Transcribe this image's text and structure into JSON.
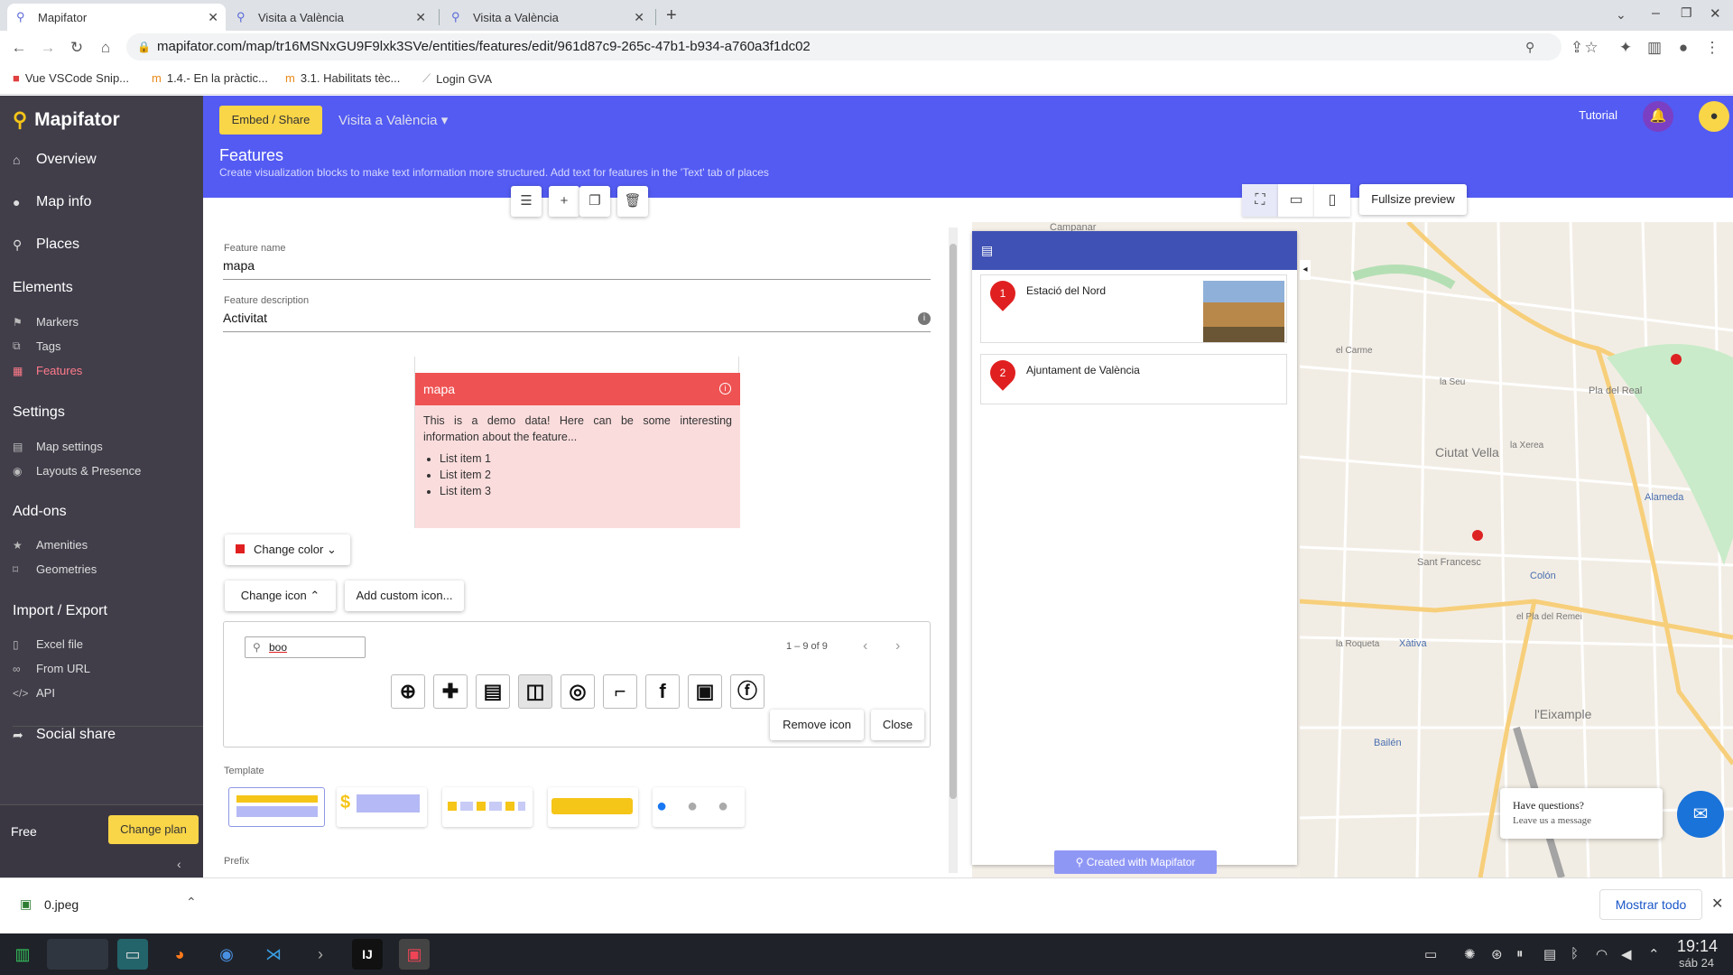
{
  "browser": {
    "tabs": [
      {
        "title": "Mapifator"
      },
      {
        "title": "Visita a València"
      },
      {
        "title": "Visita a València"
      }
    ],
    "url": "mapifator.com/map/tr16MSNxGU9F9lxk3SVe/entities/features/edit/961d87c9-265c-47b1-b934-a760a3f1dc02",
    "bookmarks": [
      "Vue VSCode Snip...",
      "1.4.- En la pràctic...",
      "3.1. Habilitats tèc...",
      "Login GVA"
    ]
  },
  "sidebar": {
    "logo": "Mapifator",
    "main": [
      "Overview",
      "Map info",
      "Places"
    ],
    "sections": [
      {
        "title": "Elements",
        "items": [
          "Markers",
          "Tags",
          "Features"
        ]
      },
      {
        "title": "Settings",
        "items": [
          "Map settings",
          "Layouts & Presence"
        ]
      },
      {
        "title": "Add-ons",
        "items": [
          "Amenities",
          "Geometries"
        ]
      },
      {
        "title": "Import / Export",
        "items": [
          "Excel file",
          "From URL",
          "API"
        ]
      }
    ],
    "social_share": "Social share",
    "plan": "Free",
    "change_plan": "Change plan"
  },
  "header": {
    "embed_share": "Embed / Share",
    "map_name": "Visita a València",
    "tutorial": "Tutorial",
    "title": "Features",
    "description": "Create visualization blocks to make text information more structured. Add text for features in the 'Text' tab of places"
  },
  "preview_buttons": {
    "fullsize": "Fullsize preview"
  },
  "form": {
    "feature_name_label": "Feature name",
    "feature_name": "mapa",
    "feature_description_label": "Feature description",
    "feature_description": "Activitat",
    "card": {
      "title": "mapa",
      "body": "This is a demo data! Here can be some interesting information about the feature...",
      "list": [
        "List item 1",
        "List item 2",
        "List item 3"
      ]
    },
    "change_color": "Change color",
    "change_icon": "Change icon",
    "add_custom_icon": "Add custom icon...",
    "icon_search": "boo",
    "pagination": "1 – 9 of 9",
    "remove_icon": "Remove icon",
    "close": "Close",
    "template_label": "Template",
    "prefix_label": "Prefix",
    "accent_color": "#ef5252"
  },
  "map_panel": {
    "places": [
      {
        "number": "1",
        "name": "Estació del Nord"
      },
      {
        "number": "2",
        "name": "Ajuntament de València"
      }
    ],
    "credit": "Created with Mapifator",
    "chat_title": "Have questions?",
    "chat_sub": "Leave us a message",
    "labels": [
      "Ciutat Vella",
      "Sant Francesc",
      "Xàtiva",
      "Colón",
      "Alameda",
      "l'Eixample",
      "Bailén",
      "Pla del Real",
      "el Pla del Remei",
      "la Roqueta",
      "la Xerea",
      "el Carme",
      "la Seu",
      "Campanar"
    ]
  },
  "downloads": {
    "file": "0.jpeg",
    "show_all": "Mostrar todo"
  },
  "clock": {
    "time": "19:14",
    "date": "sáb 24"
  }
}
